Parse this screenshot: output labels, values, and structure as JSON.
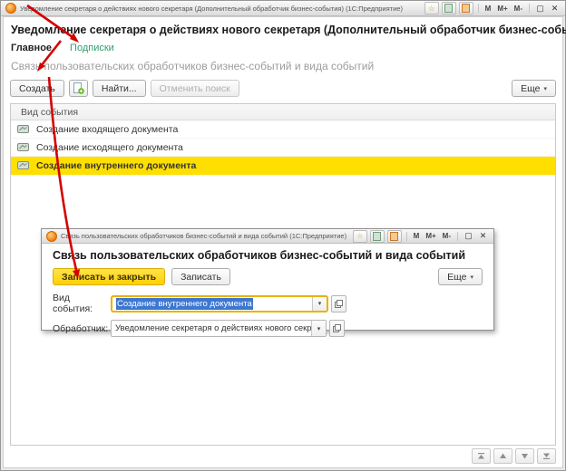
{
  "colors": {
    "selection_yellow": "#ffdf00",
    "tab_green": "#2fa06e",
    "arrow_red": "#d40000",
    "primary_button_yellow": "#ffd800",
    "focus_border_yellow": "#e8b200",
    "text_selection_blue": "#3c77d2"
  },
  "icons": {
    "caret_down": "▾",
    "maximize": "▢",
    "close": "✕",
    "star": "☆"
  },
  "main_window": {
    "titlebar": {
      "title": "Уведомление секретаря о действиях нового секретаря (Дополнительный обработчик бизнес-события)  (1С:Предприятие)",
      "font_buttons": [
        "M",
        "M+",
        "M-"
      ]
    },
    "heading": "Уведомление секретаря о действиях нового секретаря (Дополнительный обработчик бизнес-события)",
    "tabs": [
      {
        "label": "Главное",
        "active": true
      },
      {
        "label": "Подписки",
        "active": false
      }
    ],
    "subtitle": "Связь пользовательских обработчиков бизнес-событий и вида событий",
    "toolbar": {
      "create_label": "Создать",
      "find_label": "Найти...",
      "cancel_search_label": "Отменить поиск",
      "more_label": "Еще"
    },
    "list": {
      "header": "Вид события",
      "rows": [
        {
          "label": "Создание входящего документа",
          "selected": false
        },
        {
          "label": "Создание исходящего документа",
          "selected": false
        },
        {
          "label": "Создание внутреннего документа",
          "selected": true
        }
      ]
    }
  },
  "dialog": {
    "titlebar": {
      "title": "Связь пользовательских обработчиков бизнес-событий и вида событий  (1С:Предприятие)",
      "font_buttons": [
        "M",
        "M+",
        "M-"
      ]
    },
    "heading": "Связь пользовательских обработчиков бизнес-событий и вида событий",
    "buttons": {
      "save_close_label": "Записать и закрыть",
      "save_label": "Записать",
      "more_label": "Еще"
    },
    "fields": [
      {
        "label": "Вид события:",
        "value": "Создание внутреннего документа"
      },
      {
        "label": "Обработчик:",
        "value": "Уведомление секретаря о действиях нового секретаря"
      }
    ]
  }
}
